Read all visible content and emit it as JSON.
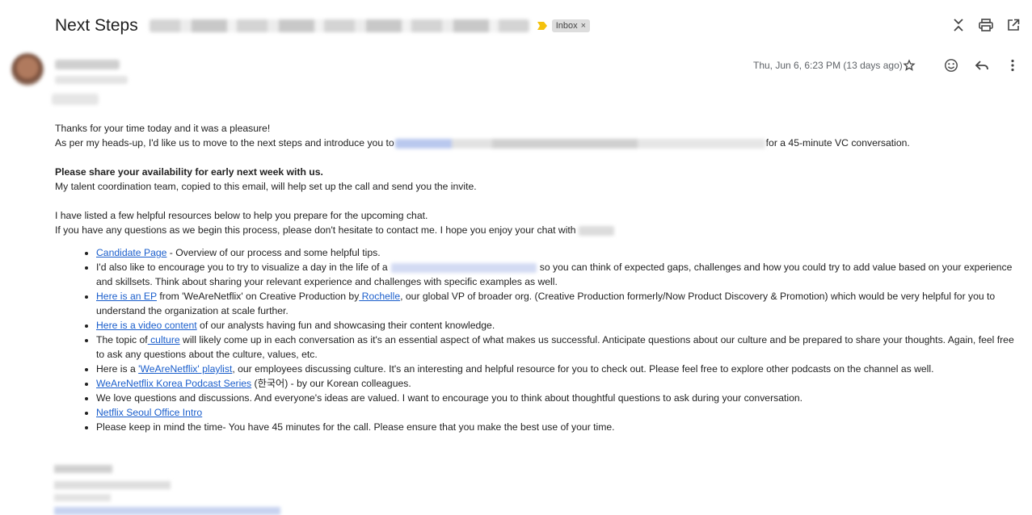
{
  "email": {
    "subject": "Next Steps",
    "label": "Inbox",
    "label_remove": "×",
    "date": "Thu, Jun 6, 6:23 PM (13 days ago)"
  },
  "body": {
    "line1": "Thanks for your time today and it was a pleasure!",
    "line2_a": "As per my heads-up, I'd like us to move to the next steps and introduce you to",
    "line2_b": "for a 45-minute VC conversation.",
    "line3": "Please share your availability for early next week with us.",
    "line4": "My talent coordination team, copied to this email, will help set up the call and send you the invite.",
    "line5": "I have listed a few helpful resources below to help you prepare for the upcoming chat.",
    "line6": "If you have any questions as we begin this process, please don't hesitate to contact me. I hope you enjoy your chat with"
  },
  "resources": {
    "r1_link": "Candidate Page",
    "r1_text": " - Overview of our process and some helpful tips.",
    "r2_a": " I'd also like to encourage you to try to visualize a day in the life of a",
    "r2_b": "so you can think of expected gaps, challenges and how you could try to add value based on your experience and skillsets. Think about sharing your relevant experience and challenges with specific examples as well.",
    "r3_link": "Here is an EP",
    "r3_a": " from 'WeAreNetflix' on Creative Production by",
    "r3_link2": " Rochelle",
    "r3_b": ", our global VP of broader org. (Creative Production formerly/Now Product Discovery & Promotion)  which would be very helpful for you to understand the organization at scale further.",
    "r4_link": "Here is a video content",
    "r4_text": " of our analysts having fun and showcasing their content knowledge.",
    "r5_a": "The topic of",
    "r5_link": " culture",
    "r5_b": " will likely come up in each conversation as it's an essential aspect of what makes us successful. Anticipate questions about our culture and be prepared to share your thoughts. Again, feel free to ask any questions about the culture, values, etc.",
    "r6_a": "Here is a ",
    "r6_link": "'WeAreNetflix' playlist",
    "r6_b": ", our employees discussing culture. It's an interesting and helpful resource for you to check out. Please feel free to explore other podcasts on the channel as well.",
    "r7_link": "WeAreNetflix Korea Podcast Series",
    "r7_text": " (한국어) - by our Korean colleagues.",
    "r8_text": "We love questions and discussions. And everyone's ideas are valued. I want to encourage you to think about thoughtful questions to ask during your conversation.",
    "r9_link": "Netflix Seoul Office Intro",
    "r10_text": "Please keep in mind the time- You have 45 minutes for the call. Please ensure that you make the best use of your time."
  },
  "colors": {
    "link": "#1a5ecc",
    "important_marker": "#f4c20d",
    "label_bg": "#dddddd"
  },
  "icons": [
    "collapse-icon",
    "print-icon",
    "open-new-window-icon",
    "star-icon",
    "emoji-icon",
    "reply-icon",
    "more-vert-icon",
    "important-marker-icon"
  ]
}
